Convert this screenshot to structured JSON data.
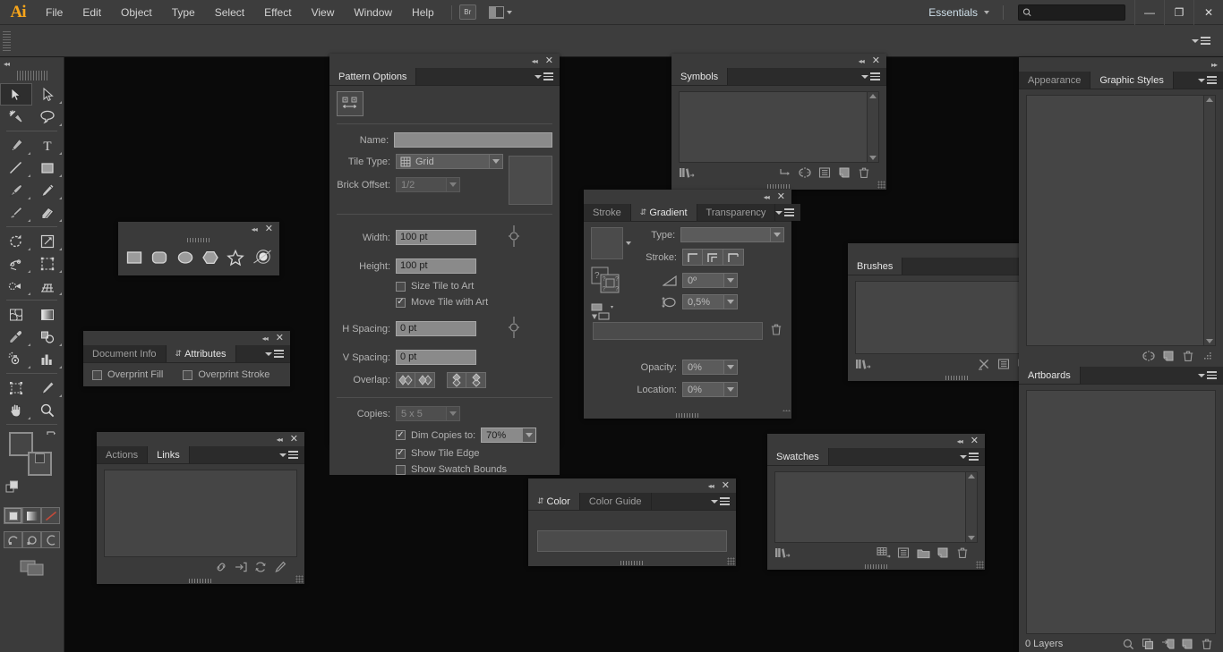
{
  "app": {
    "logo": "Ai",
    "menus": [
      "File",
      "Edit",
      "Object",
      "Type",
      "Select",
      "Effect",
      "View",
      "Window",
      "Help"
    ],
    "bridge_button": "Br",
    "workspace": "Essentials",
    "search_placeholder": "",
    "search_value": "",
    "window_buttons": {
      "minimize": "—",
      "restore": "❐",
      "close": "✕"
    }
  },
  "panels": {
    "shape_tools": {
      "tools": [
        "rectangle-tool",
        "rounded-rectangle-tool",
        "ellipse-tool",
        "polygon-tool",
        "star-tool",
        "flare-tool"
      ]
    },
    "pattern_options": {
      "title": "Pattern Options",
      "tabs": [
        "Pattern Options"
      ],
      "name_label": "Name:",
      "name_value": "",
      "tile_type_label": "Tile Type:",
      "tile_type_value": "Grid",
      "brick_offset_label": "Brick Offset:",
      "brick_offset_value": "1/2",
      "width_label": "Width:",
      "width_value": "100 pt",
      "height_label": "Height:",
      "height_value": "100 pt",
      "size_tile_to_art": "Size Tile to Art",
      "size_tile_to_art_checked": false,
      "move_tile_with_art": "Move Tile with Art",
      "move_tile_with_art_checked": true,
      "h_spacing_label": "H Spacing:",
      "h_spacing_value": "0 pt",
      "v_spacing_label": "V Spacing:",
      "v_spacing_value": "0 pt",
      "overlap_label": "Overlap:",
      "copies_label": "Copies:",
      "copies_value": "5 x 5",
      "dim_copies_label": "Dim Copies to:",
      "dim_copies_checked": true,
      "dim_copies_value": "70%",
      "show_tile_edge": "Show Tile Edge",
      "show_tile_edge_checked": true,
      "show_swatch_bounds": "Show Swatch Bounds",
      "show_swatch_bounds_checked": false
    },
    "symbols": {
      "title": "Symbols",
      "tabs": [
        "Symbols"
      ]
    },
    "gradient": {
      "tabs": [
        "Stroke",
        "Gradient",
        "Transparency"
      ],
      "active_tab": "Gradient",
      "type_label": "Type:",
      "type_value": "",
      "stroke_label": "Stroke:",
      "angle_value": "0º",
      "aspect_value": "0,5%",
      "opacity_label": "Opacity:",
      "opacity_value": "0%",
      "location_label": "Location:",
      "location_value": "0%"
    },
    "brushes": {
      "title": "Brushes",
      "tabs": [
        "Brushes"
      ]
    },
    "document_info": {
      "tabs": [
        "Document Info",
        "Attributes"
      ],
      "active_tab": "Attributes",
      "overprint_fill": "Overprint Fill",
      "overprint_fill_checked": false,
      "overprint_stroke": "Overprint Stroke",
      "overprint_stroke_checked": false
    },
    "actions_links": {
      "tabs": [
        "Actions",
        "Links"
      ],
      "active_tab": "Links"
    },
    "color": {
      "tabs": [
        "Color",
        "Color Guide"
      ],
      "active_tab": "Color"
    },
    "swatches": {
      "title": "Swatches",
      "tabs": [
        "Swatches"
      ]
    },
    "appearance": {
      "tabs": [
        "Appearance",
        "Graphic Styles"
      ],
      "active_tab": "Graphic Styles"
    },
    "artboards": {
      "title": "Artboards"
    },
    "layers": {
      "count_label": "0 Layers"
    }
  },
  "colors": {
    "accent": "#f7a51a",
    "panel_bg": "#3a3a3a",
    "panel_tab_bg": "#2b2b2b",
    "canvas_bg": "#0a0a0a",
    "menubar_bg": "#3d3d3d",
    "field_bg": "#8a8a8a",
    "list_bg": "#454545"
  }
}
